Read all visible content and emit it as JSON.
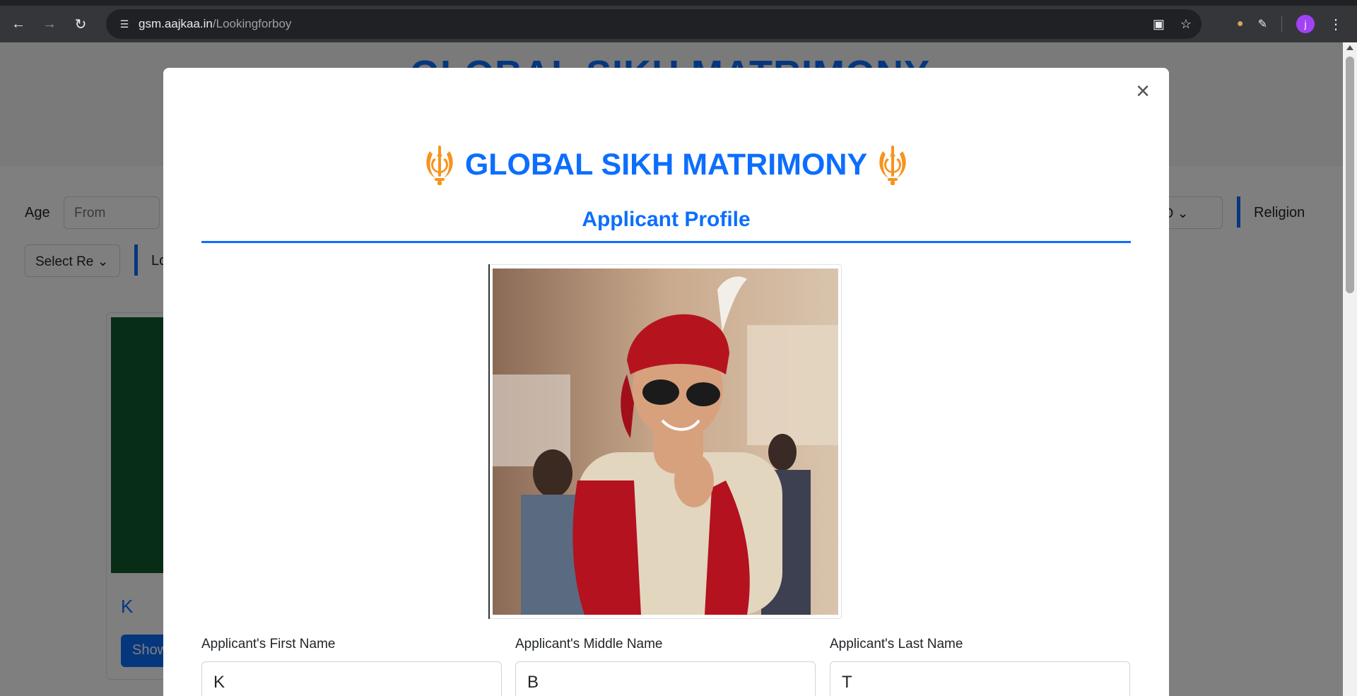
{
  "browser": {
    "url_host": "gsm.aajkaa.in",
    "url_path": "/Lookingforboy",
    "profile_initial": "j"
  },
  "background_page": {
    "hero_title": "GLOBAL SIKH MATRIMONY",
    "age_label": "Age",
    "age_from_placeholder": "From",
    "select_partial": "Select Re",
    "lo_partial": "Lo",
    "country_partial": "t O",
    "religion_label": "Religion",
    "card_name": "K",
    "card_button": "Show"
  },
  "modal": {
    "brand_title": "GLOBAL SIKH MATRIMONY",
    "subtitle": "Applicant Profile",
    "close_symbol": "×",
    "fields": {
      "first_name_label": "Applicant's First Name",
      "first_name_value": "K",
      "middle_name_label": "Applicant's Middle Name",
      "middle_name_value": "B",
      "last_name_label": "Applicant's Last Name",
      "last_name_value": "T"
    }
  },
  "colors": {
    "brand_blue": "#0d6efd",
    "khanda_orange": "#f7931e"
  }
}
